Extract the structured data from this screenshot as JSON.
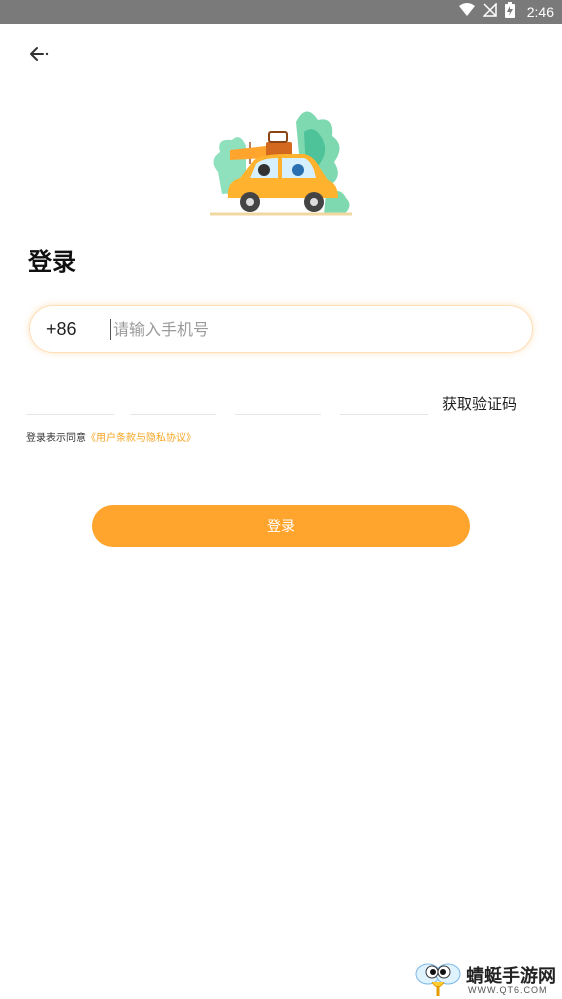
{
  "status_bar": {
    "time": "2:46"
  },
  "page": {
    "title": "登录",
    "country_code": "+86",
    "phone_placeholder": "请输入手机号",
    "get_code_label": "获取验证码",
    "agreement_prefix": "登录表示同意",
    "agreement_link": "《用户条款与隐私协议》",
    "login_button": "登录"
  },
  "watermark": {
    "title": "蜻蜓手游网",
    "url": "WWW.QT6.COM"
  },
  "colors": {
    "accent": "#ffa42c",
    "status_bar": "#7a7a7a",
    "link": "#f5a623"
  }
}
